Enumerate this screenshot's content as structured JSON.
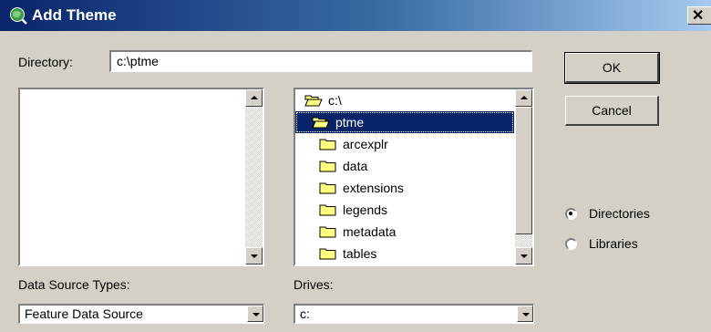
{
  "window": {
    "title": "Add Theme",
    "close_glyph": "✕"
  },
  "directory": {
    "label": "Directory:",
    "value": "c:\\ptme"
  },
  "buttons": {
    "ok": "OK",
    "cancel": "Cancel"
  },
  "dir_tree": {
    "items": [
      {
        "label": "c:\\",
        "icon": "open-folder-icon",
        "selected": false
      },
      {
        "label": "ptme",
        "icon": "open-folder-icon",
        "selected": true
      },
      {
        "label": "arcexplr",
        "icon": "folder-icon",
        "selected": false
      },
      {
        "label": "data",
        "icon": "folder-icon",
        "selected": false
      },
      {
        "label": "extensions",
        "icon": "folder-icon",
        "selected": false
      },
      {
        "label": "legends",
        "icon": "folder-icon",
        "selected": false
      },
      {
        "label": "metadata",
        "icon": "folder-icon",
        "selected": false
      },
      {
        "label": "tables",
        "icon": "folder-icon",
        "selected": false
      }
    ]
  },
  "view_mode": {
    "options": [
      {
        "label": "Directories",
        "checked": true
      },
      {
        "label": "Libraries",
        "checked": false
      }
    ]
  },
  "data_source_types": {
    "label": "Data Source Types:",
    "value": "Feature Data Source"
  },
  "drives": {
    "label": "Drives:",
    "value": "c:"
  },
  "colors": {
    "title_bar_start": "#0a246a",
    "title_bar_end": "#a6caf0",
    "selection": "#0a246a",
    "folder": "#ffff80"
  }
}
